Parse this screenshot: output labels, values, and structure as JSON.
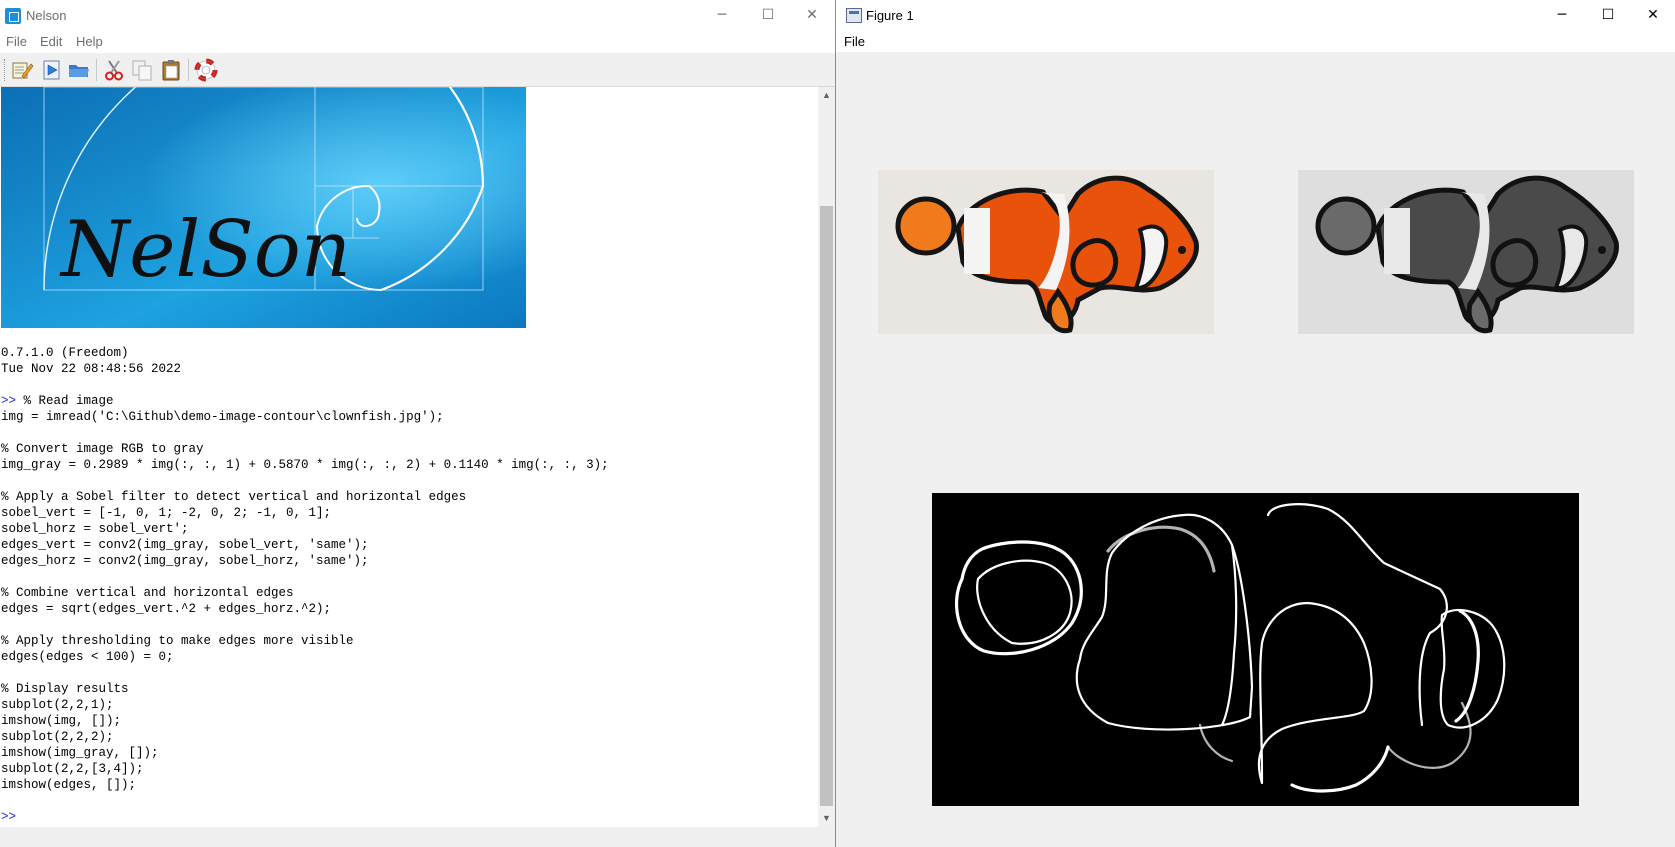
{
  "console_window": {
    "title": "Nelson",
    "menu": [
      "File",
      "Edit",
      "Help"
    ],
    "toolbar": [
      "edit-icon",
      "run-icon",
      "open-folder-icon",
      "cut-icon",
      "copy-icon",
      "paste-icon",
      "help-lifebuoy-icon"
    ],
    "banner": {
      "logo_text": "NelSon",
      "colors": {
        "top": "#0b6fb6",
        "bottom": "#31b4ea"
      }
    },
    "lines": [
      {
        "p": "",
        "t": "0.7.1.0 (Freedom)"
      },
      {
        "p": "",
        "t": "Tue Nov 22 08:48:56 2022"
      },
      {
        "p": "",
        "t": ""
      },
      {
        "p": ">>",
        "t": " % Read image"
      },
      {
        "p": "",
        "t": "img = imread('C:\\Github\\demo-image-contour\\clownfish.jpg');"
      },
      {
        "p": "",
        "t": ""
      },
      {
        "p": "",
        "t": "% Convert image RGB to gray"
      },
      {
        "p": "",
        "t": "img_gray = 0.2989 * img(:, :, 1) + 0.5870 * img(:, :, 2) + 0.1140 * img(:, :, 3);"
      },
      {
        "p": "",
        "t": ""
      },
      {
        "p": "",
        "t": "% Apply a Sobel filter to detect vertical and horizontal edges"
      },
      {
        "p": "",
        "t": "sobel_vert = [-1, 0, 1; -2, 0, 2; -1, 0, 1];"
      },
      {
        "p": "",
        "t": "sobel_horz = sobel_vert';"
      },
      {
        "p": "",
        "t": "edges_vert = conv2(img_gray, sobel_vert, 'same');"
      },
      {
        "p": "",
        "t": "edges_horz = conv2(img_gray, sobel_horz, 'same');"
      },
      {
        "p": "",
        "t": ""
      },
      {
        "p": "",
        "t": "% Combine vertical and horizontal edges"
      },
      {
        "p": "",
        "t": "edges = sqrt(edges_vert.^2 + edges_horz.^2);"
      },
      {
        "p": "",
        "t": ""
      },
      {
        "p": "",
        "t": "% Apply thresholding to make edges more visible"
      },
      {
        "p": "",
        "t": "edges(edges < 100) = 0;"
      },
      {
        "p": "",
        "t": ""
      },
      {
        "p": "",
        "t": "% Display results"
      },
      {
        "p": "",
        "t": "subplot(2,2,1);"
      },
      {
        "p": "",
        "t": "imshow(img, []);"
      },
      {
        "p": "",
        "t": "subplot(2,2,2);"
      },
      {
        "p": "",
        "t": "imshow(img_gray, []);"
      },
      {
        "p": "",
        "t": "subplot(2,2,[3,4]);"
      },
      {
        "p": "",
        "t": "imshow(edges, []);"
      },
      {
        "p": "",
        "t": ""
      },
      {
        "p": ">>",
        "t": ""
      }
    ]
  },
  "figure_window": {
    "title": "Figure 1",
    "menu": [
      "File"
    ],
    "images": {
      "color": {
        "body": "#e8520a",
        "fin": "#f07a1c",
        "band": "#f4f4f4",
        "edge": "#141414",
        "bg": "#e9e6e2"
      },
      "gray": {
        "body": "#4a4a4a",
        "fin": "#6a6a6a",
        "band": "#e8e8e8",
        "edge": "#111111",
        "bg": "#dedede"
      },
      "edges": {
        "line": "#ffffff",
        "bg": "#000000"
      }
    }
  }
}
